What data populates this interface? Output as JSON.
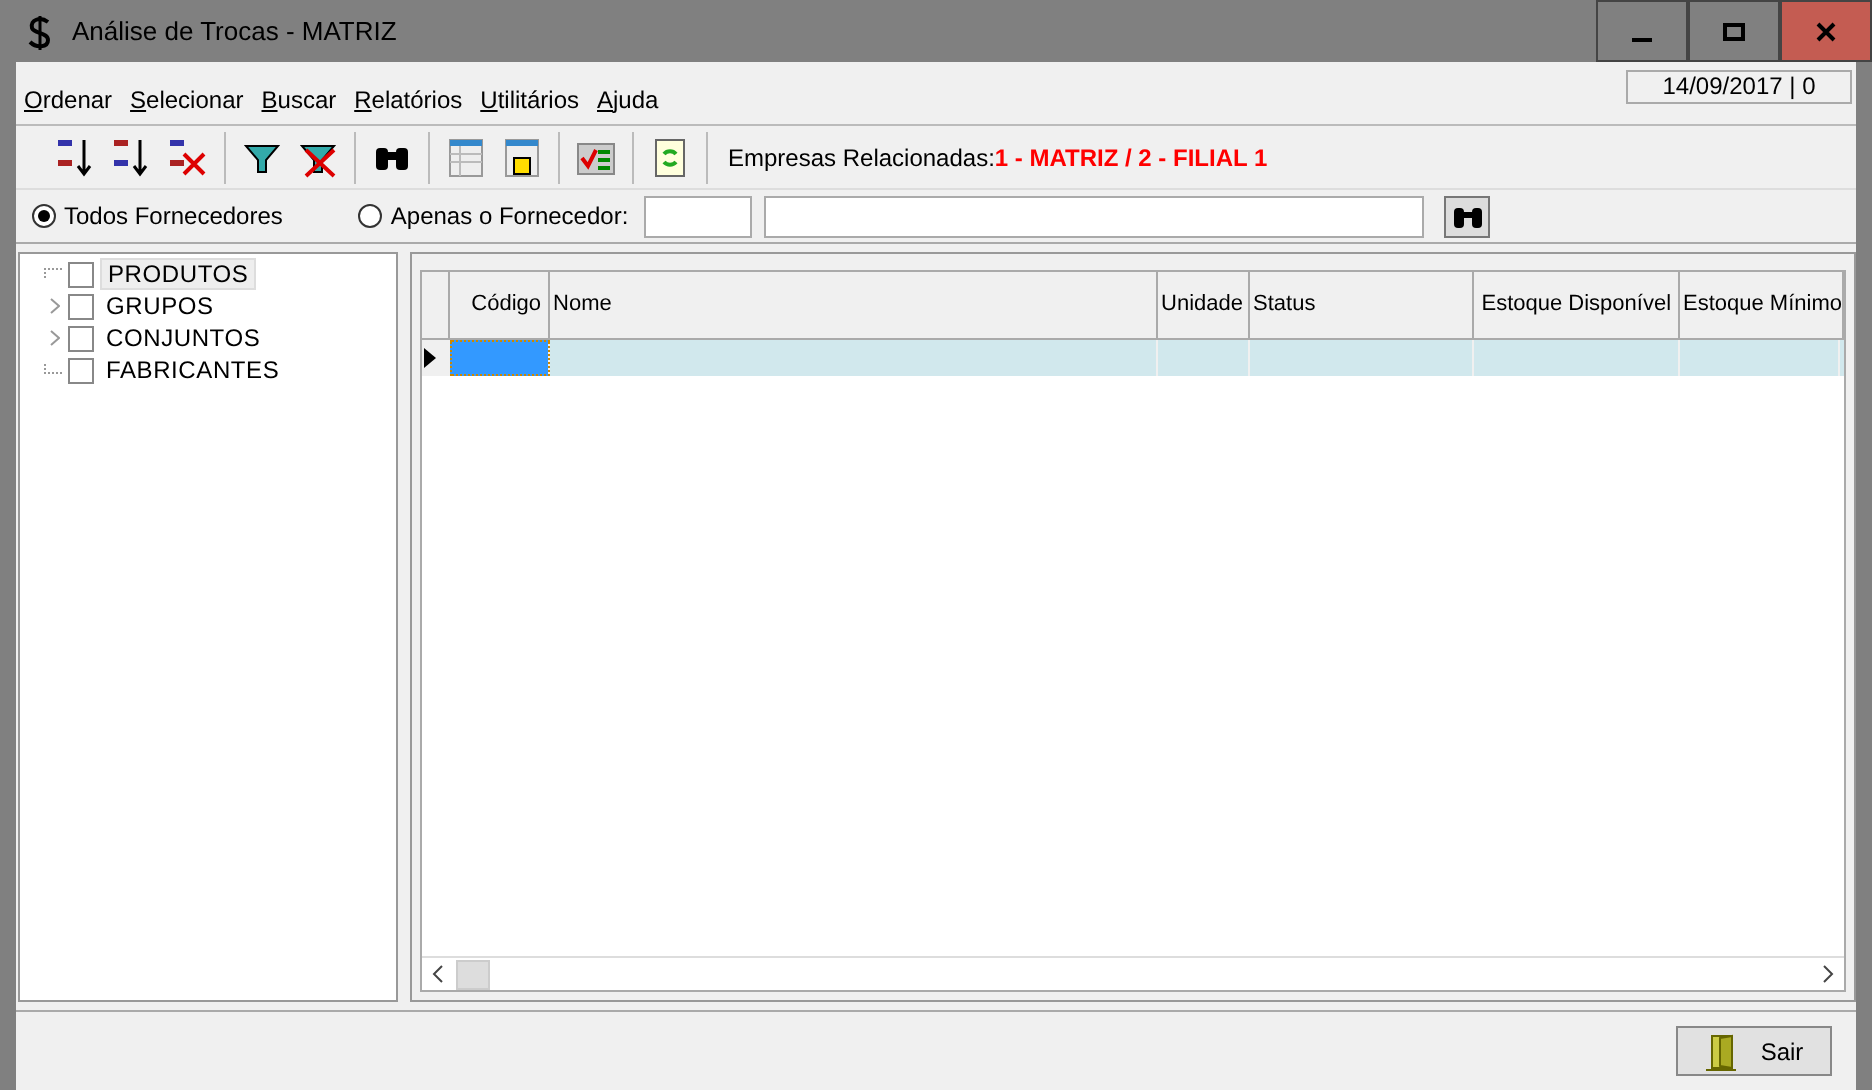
{
  "window": {
    "title": "Análise de Trocas - MATRIZ"
  },
  "menu": [
    {
      "label": "Ordenar"
    },
    {
      "label": "Selecionar"
    },
    {
      "label": "Buscar"
    },
    {
      "label": "Relatórios"
    },
    {
      "label": "Utilitários"
    },
    {
      "label": "Ajuda"
    }
  ],
  "date_box": "14/09/2017 | 0",
  "toolbar": {
    "groups": [
      [
        {
          "kind": "sort-asc"
        },
        {
          "kind": "sort-desc"
        },
        {
          "kind": "sort-clear"
        }
      ],
      [
        {
          "kind": "filter"
        },
        {
          "kind": "filter-clear"
        }
      ],
      [
        {
          "kind": "find"
        }
      ],
      [
        {
          "kind": "grid"
        },
        {
          "kind": "grid-hand"
        }
      ],
      [
        {
          "kind": "money"
        }
      ],
      [
        {
          "kind": "refresh"
        }
      ]
    ],
    "companies_label": "Empresas Relacionadas:",
    "companies_value": "1 - MATRIZ / 2 - FILIAL 1"
  },
  "supplier_filter": {
    "options": [
      {
        "label": "Todos Fornecedores",
        "selected": true
      },
      {
        "label": "Apenas o Fornecedor:",
        "selected": false
      }
    ]
  },
  "tree": [
    {
      "label": "PRODUTOS",
      "checked": false,
      "selected": true
    },
    {
      "label": "GRUPOS",
      "checked": false,
      "selected": false,
      "expanded": false
    },
    {
      "label": "CONJUNTOS",
      "checked": false,
      "selected": false,
      "expanded": false
    },
    {
      "label": "FABRICANTES",
      "checked": false,
      "selected": false
    }
  ],
  "grid": {
    "columns": [
      {
        "label": "Código",
        "numeric": true
      },
      {
        "label": "Nome",
        "numeric": false
      },
      {
        "label": "Unidade",
        "numeric": false
      },
      {
        "label": "Status",
        "numeric": false
      },
      {
        "label": "Estoque Disponível",
        "numeric": true
      },
      {
        "label": "Estoque Mínimo",
        "numeric": false
      }
    ],
    "rows": [
      {
        "current": true
      }
    ]
  },
  "buttons": [
    {
      "label": "Sair"
    }
  ]
}
